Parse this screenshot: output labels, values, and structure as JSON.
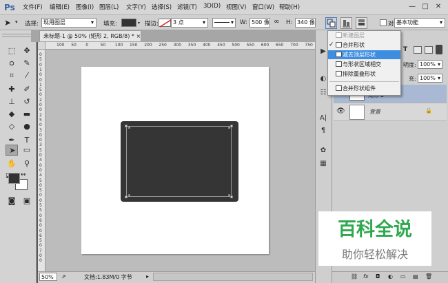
{
  "app": {
    "logo": "Ps"
  },
  "menubar": {
    "items": [
      "文件(F)",
      "编辑(E)",
      "图像(I)",
      "图层(L)",
      "文字(Y)",
      "选择(S)",
      "滤镜(T)",
      "3D(D)",
      "视图(V)",
      "窗口(W)",
      "帮助(H)"
    ]
  },
  "window_controls": {
    "minimize": "—",
    "restore": "□",
    "close": "✕"
  },
  "options": {
    "select_label": "选择:",
    "select_value": "现用图层",
    "fill_label": "填充:",
    "stroke_label": "描边:",
    "stroke_width": "3 点",
    "w_label": "W:",
    "w_value": "500 像素",
    "link_icon": "∞",
    "h_label": "H:",
    "h_value": "340 像素",
    "workspace": "基本功能"
  },
  "document": {
    "tab_title": "未标题-1 @ 50% (矩形 2, RGB/8) *",
    "tab_close": "×",
    "ruler_top_labels": [
      "100",
      "50",
      "0",
      "50",
      "100",
      "150",
      "200",
      "250",
      "300",
      "350",
      "400",
      "450",
      "500",
      "550",
      "600",
      "650",
      "700",
      "750"
    ],
    "ruler_left_labels": [
      "0",
      "5",
      "0",
      "1",
      "0",
      "0",
      "1",
      "5",
      "0",
      "2",
      "0",
      "0",
      "2",
      "5",
      "0",
      "3",
      "0",
      "0",
      "3",
      "5",
      "0",
      "4",
      "0",
      "0",
      "4",
      "5",
      "0",
      "5",
      "0",
      "0",
      "5",
      "5",
      "0",
      "6",
      "0",
      "0",
      "6",
      "5",
      "0",
      "7",
      "0",
      "0"
    ],
    "shape_color": "#353535"
  },
  "status": {
    "zoom": "50%",
    "doc_info": "文档:1.83M/0 字节"
  },
  "path_ops_menu": {
    "items": [
      {
        "label": "新建图层",
        "checked": false,
        "disabled": true,
        "highlighted": false
      },
      {
        "label": "合并形状",
        "checked": true,
        "disabled": false,
        "highlighted": false
      },
      {
        "label": "减去顶层形状",
        "checked": false,
        "disabled": false,
        "highlighted": true
      },
      {
        "label": "与形状区域相交",
        "checked": false,
        "disabled": false,
        "highlighted": false
      },
      {
        "label": "排除重叠形状",
        "checked": false,
        "disabled": false,
        "highlighted": false
      },
      {
        "label": "合并形状组件",
        "checked": false,
        "disabled": false,
        "highlighted": false
      }
    ],
    "check_mark": "✓",
    "highlight_color": "#3d8ee0"
  },
  "layers_panel": {
    "opacity_label": "明度:",
    "opacity_value": "100%",
    "fill_value": "100%",
    "fill_label": "充:",
    "layer_shape_name": "矩形 2",
    "layer_bg_name": "背景",
    "lock_icon": "🔒",
    "type_icon": "T",
    "footer_icons": [
      "⛓",
      "fx",
      "◘",
      "◐",
      "▭",
      "▤",
      "🗑"
    ]
  },
  "watermark": {
    "title": "百科全说",
    "subtitle": "助你轻松解决"
  }
}
